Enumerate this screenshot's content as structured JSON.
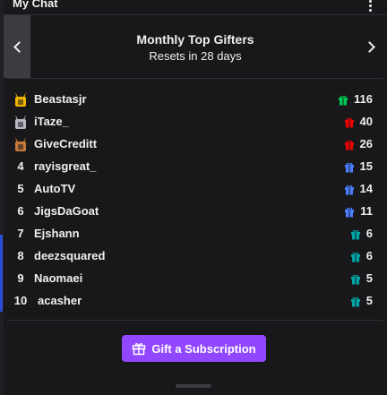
{
  "window": {
    "title": "My Chat"
  },
  "leaderboard": {
    "title": "Monthly Top Gifters",
    "subtitle": "Resets in 28 days",
    "rows": [
      {
        "rank": "1",
        "name": "Beastasjr",
        "count": "116",
        "badge": "gold-medal-badge",
        "gift_color": "#00c853"
      },
      {
        "rank": "2",
        "name": "iTaze_",
        "count": "40",
        "badge": "silver-medal-badge",
        "gift_color": "#eb0400"
      },
      {
        "rank": "3",
        "name": "GiveCreditt",
        "count": "26",
        "badge": "bronze-medal-badge",
        "gift_color": "#eb0400"
      },
      {
        "rank": "4",
        "name": "rayisgreat_",
        "count": "15",
        "badge": "",
        "gift_color": "#4a7dff"
      },
      {
        "rank": "5",
        "name": "AutoTV",
        "count": "14",
        "badge": "",
        "gift_color": "#4a7dff"
      },
      {
        "rank": "6",
        "name": "JigsDaGoat",
        "count": "11",
        "badge": "",
        "gift_color": "#4a7dff"
      },
      {
        "rank": "7",
        "name": "Ejshann",
        "count": "6",
        "badge": "",
        "gift_color": "#00a3a3"
      },
      {
        "rank": "8",
        "name": "deezsquared",
        "count": "6",
        "badge": "",
        "gift_color": "#00a3a3"
      },
      {
        "rank": "9",
        "name": "Naomaei",
        "count": "5",
        "badge": "",
        "gift_color": "#00a3a3"
      },
      {
        "rank": "10",
        "name": "acasher",
        "count": "5",
        "badge": "",
        "gift_color": "#00a3a3"
      }
    ]
  },
  "gift_button": {
    "label": "Gift a Subscription",
    "icon": "gift-icon"
  },
  "colors": {
    "accent": "#9147ff",
    "gold": "#f0b400",
    "silver": "#b8b8c0",
    "bronze": "#c47a3a"
  }
}
